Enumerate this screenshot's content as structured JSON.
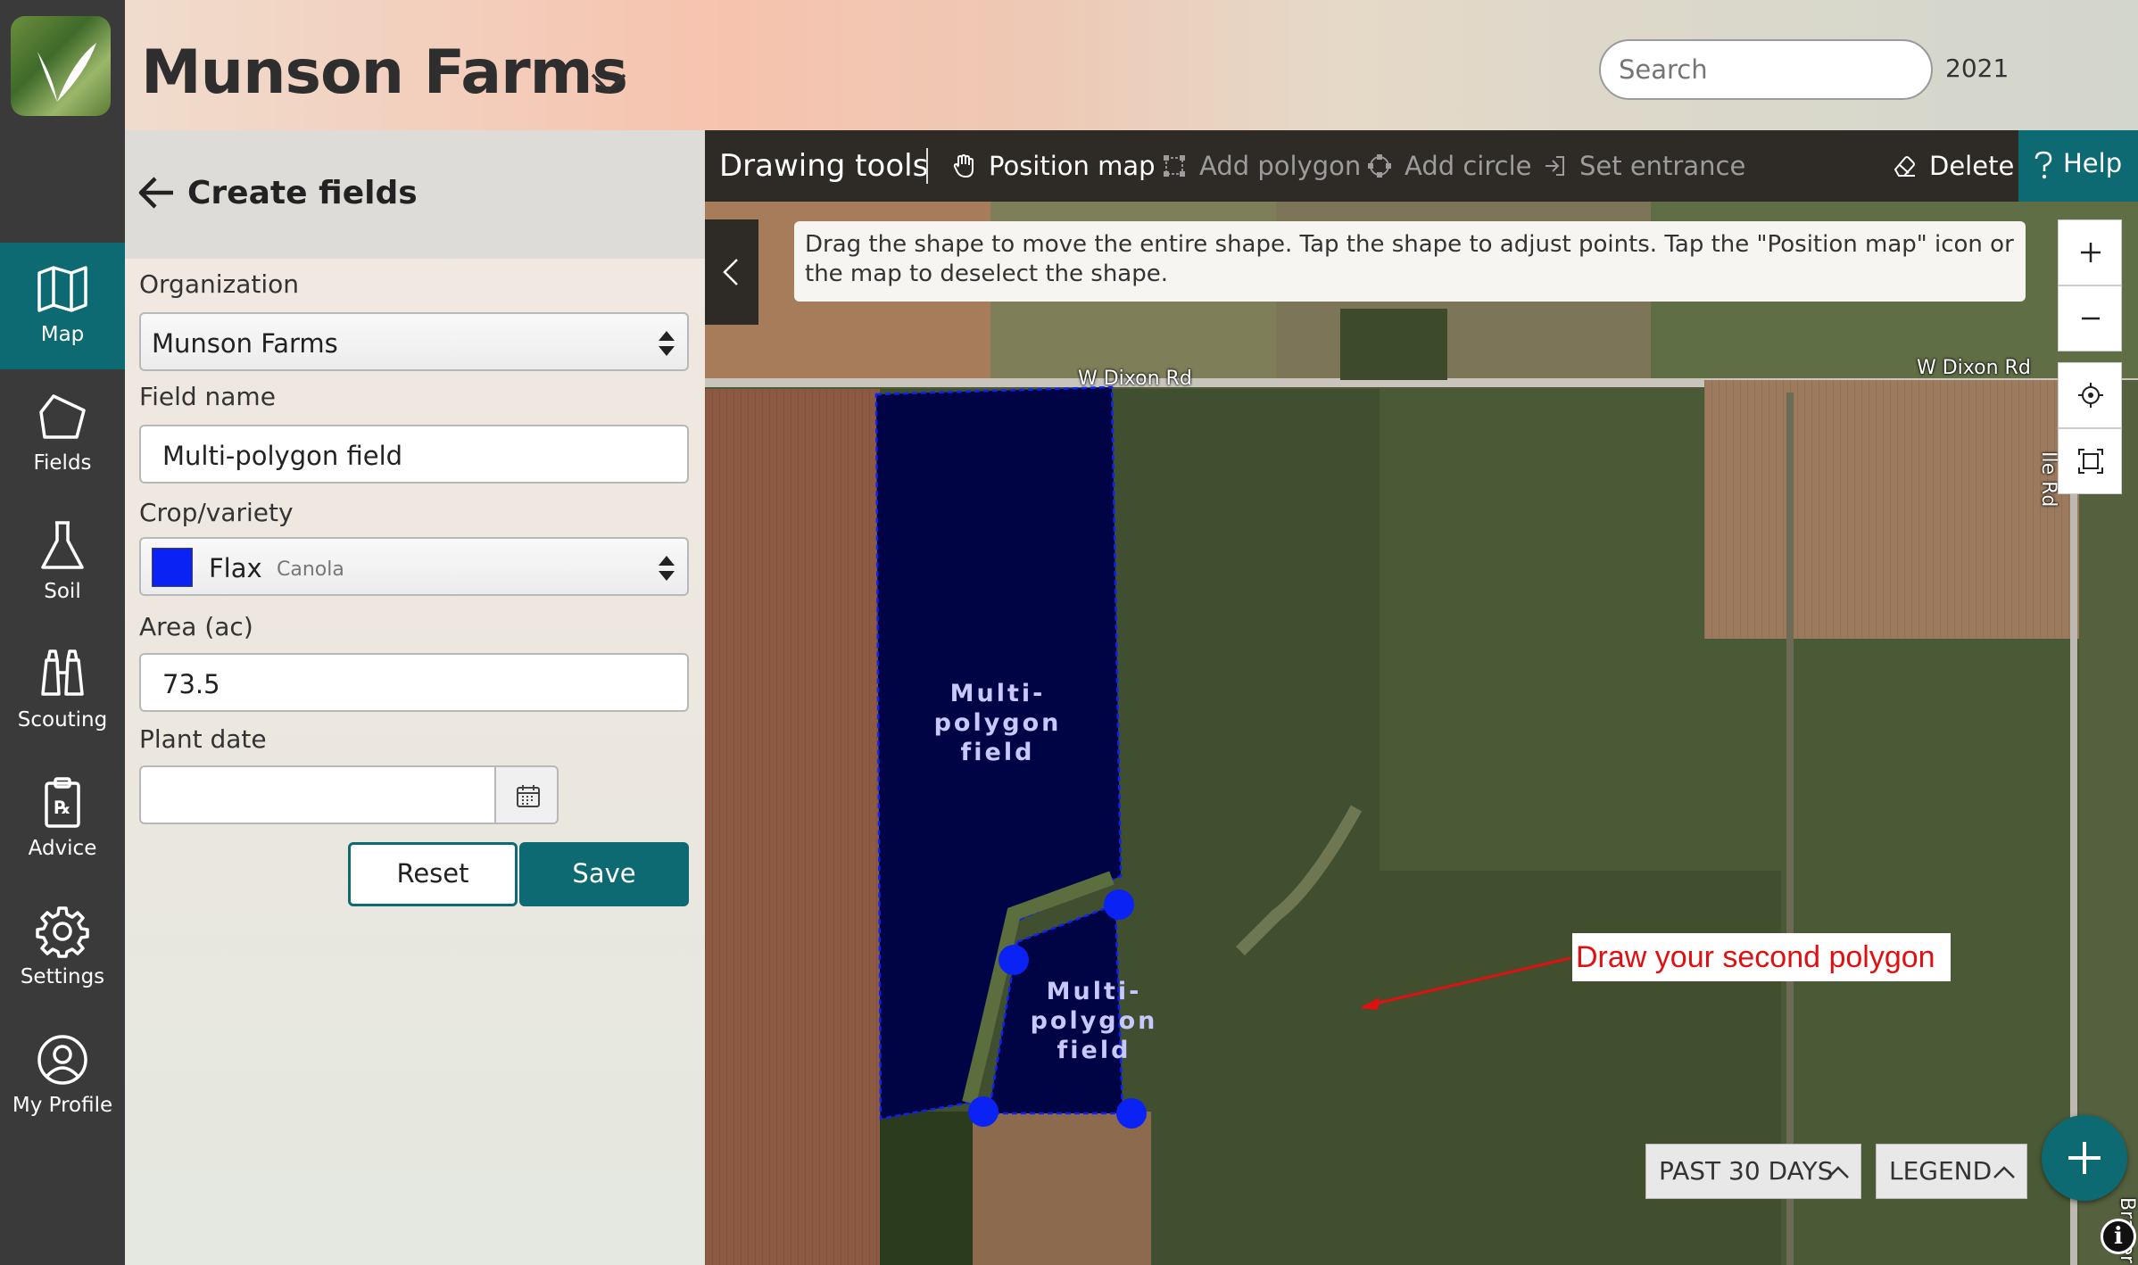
{
  "app": {
    "organization_title": "Munson Farms",
    "year": "2021",
    "search": {
      "placeholder": "Search",
      "value": ""
    },
    "brand_color": "#0e6a72"
  },
  "nav": {
    "items": [
      {
        "label": "Map",
        "icon": "map-icon",
        "active": true
      },
      {
        "label": "Fields",
        "icon": "fields-icon",
        "active": false
      },
      {
        "label": "Soil",
        "icon": "flask-icon",
        "active": false
      },
      {
        "label": "Scouting",
        "icon": "binoculars-icon",
        "active": false
      },
      {
        "label": "Advice",
        "icon": "prescription-icon",
        "active": false
      },
      {
        "label": "Settings",
        "icon": "gear-icon",
        "active": false
      },
      {
        "label": "My Profile",
        "icon": "profile-icon",
        "active": false
      }
    ]
  },
  "panel": {
    "title": "Create fields",
    "organization": {
      "label": "Organization",
      "value": "Munson Farms"
    },
    "field_name": {
      "label": "Field name",
      "value": "Multi-polygon field"
    },
    "crop": {
      "label": "Crop/variety",
      "crop": "Flax",
      "variety": "Canola",
      "swatch_color": "#0b22f5"
    },
    "area": {
      "label": "Area (ac)",
      "value": "73.5"
    },
    "plant_date": {
      "label": "Plant date",
      "value": ""
    },
    "reset_label": "Reset",
    "save_label": "Save"
  },
  "toolbar": {
    "title": "Drawing tools",
    "position_map": "Position map",
    "add_polygon": "Add polygon",
    "add_circle": "Add circle",
    "set_entrance": "Set entrance",
    "delete": "Delete",
    "help": "Help"
  },
  "map": {
    "instruction": "Drag the shape to move the entire shape. Tap the shape to adjust points. Tap the \"Position map\" icon or the map to deselect the shape.",
    "roads": {
      "dixon_left": "W Dixon Rd",
      "dixon_right": "W Dixon Rd",
      "vertical": "Ile Rd",
      "bottom": "Brauer"
    },
    "polygon_label_1": [
      "Multi-",
      "polygon",
      "field"
    ],
    "polygon_label_2": [
      "Multi-",
      "polygon",
      "field"
    ],
    "callout": "Draw your second polygon",
    "callout_color": "#e01010",
    "polygon_fill": "#000444",
    "vertex_color": "#0b22f5",
    "past_days_label": "PAST 30 DAYS",
    "legend_label": "LEGEND"
  }
}
